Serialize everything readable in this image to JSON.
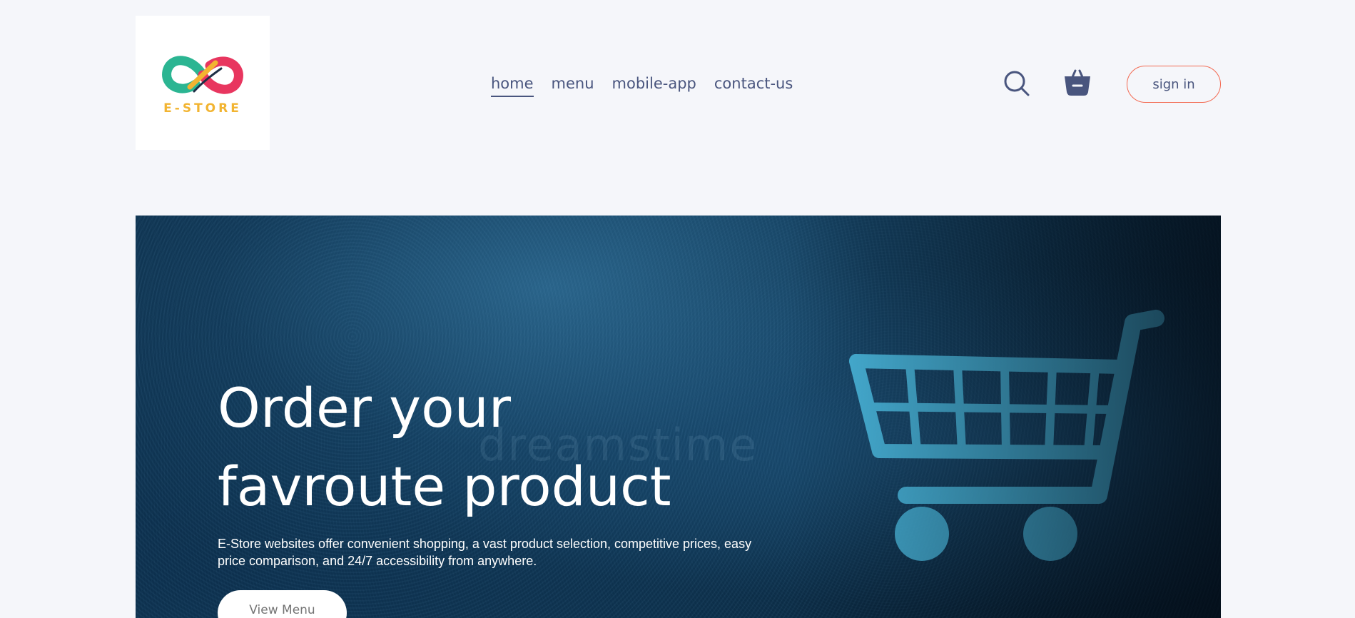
{
  "brand": {
    "logo_text": "E-STORE",
    "logo_colors": [
      "#2bb592",
      "#e8365f",
      "#f2b431"
    ]
  },
  "nav": {
    "items": [
      {
        "label": "home",
        "active": true
      },
      {
        "label": "menu",
        "active": false
      },
      {
        "label": "mobile-app",
        "active": false
      },
      {
        "label": "contact-us",
        "active": false
      }
    ],
    "search_icon": "search-icon",
    "basket_icon": "basket-icon",
    "signin_label": "sign in"
  },
  "hero": {
    "title_line1": "Order your",
    "title_line2": "favroute product",
    "description": "E-Store websites offer convenient shopping, a vast product selection, competitive prices, easy price comparison, and 24/7 accessibility from anywhere.",
    "cta_label": "View Menu",
    "image_icon": "shopping-cart-icon",
    "watermark": "dreamstime"
  },
  "colors": {
    "page_bg": "#f5f6fa",
    "nav_text": "#49557e",
    "signin_border": "#f36a52",
    "cart_color": "#4fc3ea",
    "hero_bg": "#0f3550"
  }
}
